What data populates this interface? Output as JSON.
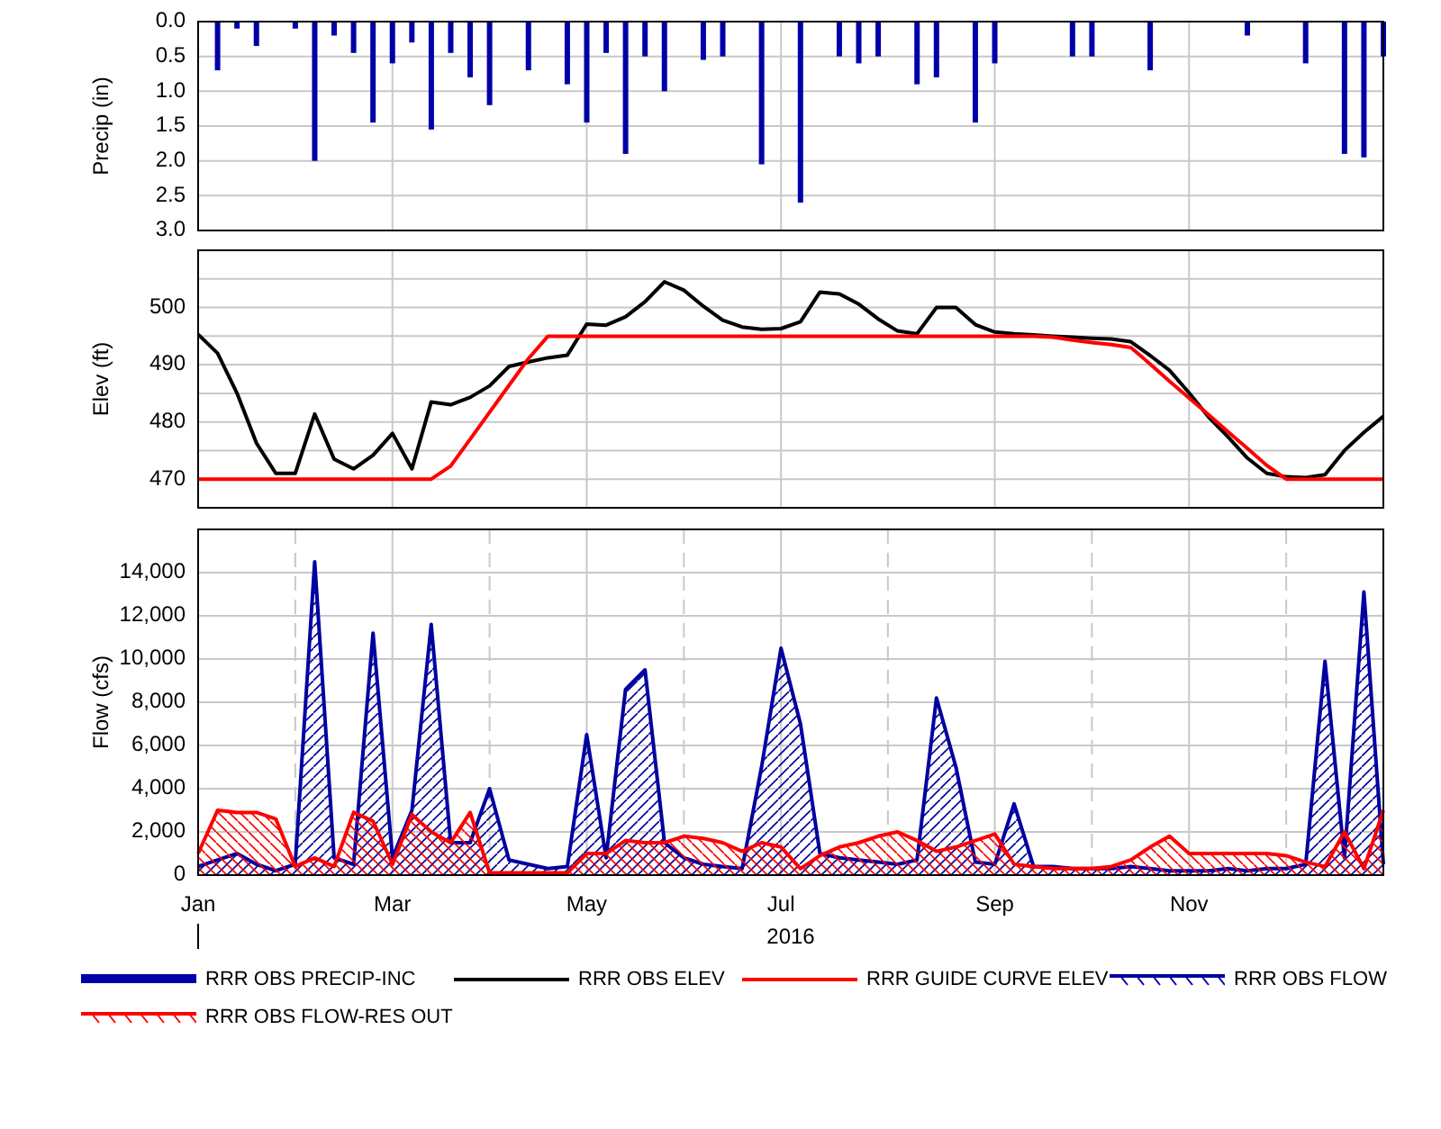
{
  "charts": [
    {
      "chart_data": {
        "type": "bar",
        "ylabel": "Precip (in)",
        "categories": [
          null,
          null,
          null,
          null,
          null,
          null,
          null,
          null,
          null,
          null,
          null,
          null,
          null,
          null,
          null,
          null,
          null,
          null,
          null,
          null,
          null,
          null,
          null,
          null,
          null,
          null,
          null,
          null,
          null,
          null,
          null,
          null,
          null,
          null,
          null,
          null,
          null,
          null,
          null,
          null,
          null,
          null,
          null,
          null,
          null,
          null,
          null,
          null,
          null,
          null,
          null,
          null,
          null,
          null,
          null,
          null,
          null,
          null,
          null,
          null,
          null,
          null
        ],
        "series": [
          {
            "name": "RRR OBS PRECIP-INC",
            "color": "#0000a8",
            "values": [
              null,
              0.7,
              0.1,
              0.35,
              null,
              0.1,
              2.0,
              0.2,
              0.45,
              1.45,
              0.6,
              0.3,
              1.55,
              0.45,
              0.8,
              1.2,
              null,
              0.7,
              null,
              0.9,
              1.45,
              0.45,
              1.9,
              0.5,
              1.0,
              null,
              0.55,
              0.5,
              null,
              2.05,
              null,
              2.6,
              null,
              0.5,
              0.6,
              0.5,
              null,
              0.9,
              0.8,
              null,
              1.45,
              0.6,
              null,
              null,
              null,
              0.5,
              0.5,
              null,
              null,
              0.7,
              null,
              null,
              null,
              null,
              0.2,
              null,
              null,
              0.6,
              null,
              1.9,
              1.95,
              0.5
            ]
          }
        ],
        "ylim": [
          3,
          0
        ],
        "grid": true,
        "yticks": [
          {
            "value": 0,
            "label": "0.0"
          },
          {
            "value": 0.5,
            "label": "0.5"
          },
          {
            "value": 1,
            "label": "1.0"
          },
          {
            "value": 1.5,
            "label": "1.5"
          },
          {
            "value": 2,
            "label": "2.0"
          },
          {
            "value": 2.5,
            "label": "2.5"
          },
          {
            "value": 3,
            "label": "3.0"
          }
        ]
      }
    },
    {
      "chart_data": {
        "type": "line",
        "ylabel": "Elev (ft)",
        "categories": [
          null,
          null,
          null,
          null,
          null,
          null,
          null,
          null,
          null,
          null,
          null,
          null,
          null,
          null,
          null,
          null,
          null,
          null,
          null,
          null,
          null,
          null,
          null,
          null,
          null,
          null,
          null,
          null,
          null,
          null,
          null,
          null,
          null,
          null,
          null,
          null,
          null,
          null,
          null,
          null,
          null,
          null,
          null,
          null,
          null,
          null,
          null,
          null,
          null,
          null,
          null,
          null,
          null,
          null,
          null,
          null,
          null,
          null,
          null,
          null,
          null,
          null
        ],
        "series": [
          {
            "name": "RRR OBS ELEV",
            "color": "#000000",
            "values": [
              495.3,
              492,
              485,
              476.3,
              471,
              471,
              481.4,
              473.5,
              471.8,
              474.2,
              478,
              471.8,
              483.5,
              483,
              484.3,
              486.3,
              489.7,
              490.5,
              491.2,
              491.7,
              497.1,
              496.9,
              498.4,
              501,
              504.5,
              503,
              500.2,
              497.8,
              496.6,
              496.2,
              496.3,
              497.5,
              502.7,
              502.4,
              500.6,
              498,
              495.9,
              495.4,
              500,
              500,
              497,
              495.7,
              495.4,
              495.2,
              495,
              494.8,
              494.6,
              494.5,
              494,
              491.6,
              489,
              485.1,
              480.9,
              477.4,
              473.7,
              471,
              470.4,
              470.3,
              470.8,
              475,
              478.2,
              481
            ]
          },
          {
            "name": "RRR GUIDE CURVE ELEV",
            "color": "#ff0000",
            "values": [
              470,
              470,
              470,
              470,
              470,
              470,
              470,
              470,
              470,
              470,
              470,
              470,
              470,
              472.3,
              477,
              481.7,
              486.4,
              491.1,
              495,
              495,
              495,
              495,
              495,
              495,
              495,
              495,
              495,
              495,
              495,
              495,
              495,
              495,
              495,
              495,
              495,
              495,
              495,
              495,
              495,
              495,
              495,
              495,
              495,
              495,
              494.8,
              494.3,
              493.9,
              493.5,
              493,
              490.1,
              487.1,
              484.2,
              481.3,
              478.3,
              475.4,
              472.4,
              470,
              470,
              470,
              470,
              470,
              470
            ]
          }
        ],
        "ylim": [
          465,
          510
        ],
        "grid": true,
        "yticks": [
          {
            "value": 470,
            "label": "470"
          },
          {
            "value": 480,
            "label": "480"
          },
          {
            "value": 490,
            "label": "490"
          },
          {
            "value": 500,
            "label": "500"
          }
        ]
      }
    },
    {
      "chart_data": {
        "type": "area",
        "ylabel": "Flow (cfs)",
        "xlabel": "2016",
        "categories": [
          "Jan",
          null,
          null,
          null,
          null,
          null,
          null,
          null,
          null,
          null,
          "Mar",
          null,
          null,
          null,
          null,
          null,
          null,
          null,
          null,
          null,
          "May",
          null,
          null,
          null,
          null,
          null,
          null,
          null,
          null,
          null,
          "Jul",
          null,
          null,
          null,
          null,
          null,
          null,
          null,
          null,
          null,
          null,
          "Sep",
          null,
          null,
          null,
          null,
          null,
          null,
          null,
          null,
          null,
          "Nov",
          null,
          null,
          null,
          null,
          null,
          null,
          null,
          null,
          null,
          null
        ],
        "series": [
          {
            "name": "RRR OBS FLOW",
            "color": "#0000a0",
            "values": [
              400,
              700,
              1000,
              500,
              200,
              500,
              14500,
              800,
              500,
              11200,
              800,
              3000,
              11600,
              1500,
              1500,
              4000,
              700,
              500,
              300,
              400,
              6500,
              800,
              8600,
              9500,
              1500,
              800,
              500,
              400,
              300,
              5000,
              10500,
              7000,
              1000,
              800,
              700,
              600,
              500,
              700,
              8200,
              5000,
              600,
              500,
              3300,
              400,
              400,
              300,
              300,
              300,
              400,
              300,
              200,
              200,
              200,
              300,
              200,
              300,
              300,
              500,
              9900,
              800,
              13100,
              500
            ]
          },
          {
            "name": "RRR OBS FLOW-RES OUT",
            "color": "#ff0000",
            "values": [
              1000,
              3000,
              2900,
              2900,
              2600,
              400,
              800,
              400,
              2900,
              2500,
              500,
              2800,
              2000,
              1500,
              2900,
              100,
              100,
              100,
              100,
              100,
              1000,
              1000,
              1600,
              1500,
              1500,
              1800,
              1700,
              1500,
              1100,
              1500,
              1300,
              300,
              900,
              1300,
              1500,
              1800,
              2000,
              1600,
              1100,
              1300,
              1600,
              1900,
              500,
              400,
              300,
              300,
              300,
              400,
              700,
              1300,
              1800,
              1000,
              1000,
              1000,
              1000,
              1000,
              900,
              600,
              400,
              2000,
              300,
              3000
            ]
          }
        ],
        "ylim": [
          0,
          16000
        ],
        "grid": true,
        "yticks": [
          {
            "value": 0,
            "label": "0"
          },
          {
            "value": 2000,
            "label": "2,000"
          },
          {
            "value": 4000,
            "label": "4,000"
          },
          {
            "value": 6000,
            "label": "6,000"
          },
          {
            "value": 8000,
            "label": "8,000"
          },
          {
            "value": 10000,
            "label": "10,000"
          },
          {
            "value": 12000,
            "label": "12,000"
          },
          {
            "value": 14000,
            "label": "14,000"
          }
        ]
      }
    }
  ]
}
